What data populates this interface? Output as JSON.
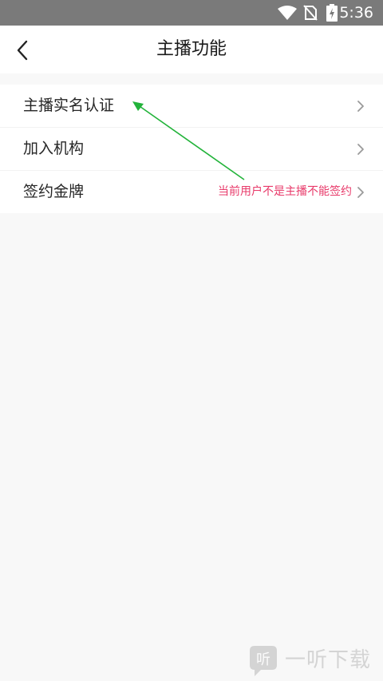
{
  "status_bar": {
    "time": "5:36",
    "icons": [
      "wifi-icon",
      "no-sim-icon",
      "battery-charging-icon"
    ]
  },
  "app_bar": {
    "title": "主播功能",
    "back_icon": "chevron-left-icon"
  },
  "menu": {
    "items": [
      {
        "label": "主播实名认证",
        "note": ""
      },
      {
        "label": "加入机构",
        "note": ""
      },
      {
        "label": "签约金牌",
        "note": "当前用户不是主播不能签约"
      }
    ]
  },
  "annotation": {
    "arrow_color": "#22b33a"
  },
  "watermark": {
    "text": "一听下载",
    "logo_glyph": "听"
  },
  "colors": {
    "note": "#e83a6a",
    "status_bar": "#7a7a7a"
  }
}
